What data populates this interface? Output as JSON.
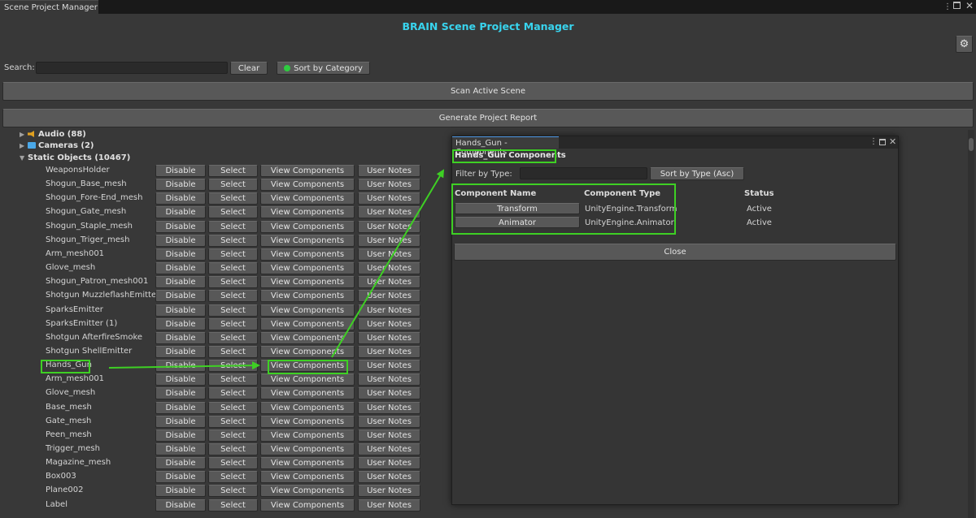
{
  "window": {
    "tab_title": "Scene Project Manager"
  },
  "header": {
    "title": "BRAIN Scene Project Manager"
  },
  "toolbar": {
    "search_label": "Search:",
    "search_value": "",
    "clear_label": "Clear",
    "sort_label": "Sort by Category",
    "scan_label": "Scan Active Scene",
    "report_label": "Generate Project Report"
  },
  "categories": [
    {
      "label": "Audio (88)",
      "expanded": false,
      "icon": "speaker-icon"
    },
    {
      "label": "Cameras (2)",
      "expanded": false,
      "icon": "camera-icon"
    },
    {
      "label": "Static Objects (10467)",
      "expanded": true,
      "icon": ""
    }
  ],
  "row_buttons": {
    "disable": "Disable",
    "select": "Select",
    "view": "View Components",
    "notes": "User Notes"
  },
  "objects": [
    "WeaponsHolder",
    "Shogun_Base_mesh",
    "Shogun_Fore-End_mesh",
    "Shogun_Gate_mesh",
    "Shogun_Staple_mesh",
    "Shogun_Triger_mesh",
    "Arm_mesh001",
    "Glove_mesh",
    "Shogun_Patron_mesh001",
    "Shotgun MuzzleflashEmitter",
    "SparksEmitter",
    "SparksEmitter (1)",
    "Shotgun AfterfireSmoke",
    "Shotgun ShellEmitter",
    "Hands_Gun",
    "Arm_mesh001",
    "Glove_mesh",
    "Base_mesh",
    "Gate_mesh",
    "Peen_mesh",
    "Trigger_mesh",
    "Magazine_mesh",
    "Box003",
    "Plane002",
    "Label"
  ],
  "popup": {
    "title": "Hands_Gun - Components",
    "heading": "Hands_Gun Components",
    "filter_label": "Filter by Type:",
    "filter_value": "",
    "sort_label": "Sort by Type (Asc)",
    "columns": [
      "Component Name",
      "Component Type",
      "Status"
    ],
    "components": [
      {
        "name": "Transform",
        "type": "UnityEngine.Transform",
        "status": "Active"
      },
      {
        "name": "Animator",
        "type": "UnityEngine.Animator",
        "status": "Active"
      }
    ],
    "close_label": "Close"
  },
  "colors": {
    "title": "#38d4ee",
    "highlight": "#3ed024",
    "sort_dot": "#2ecc40"
  }
}
